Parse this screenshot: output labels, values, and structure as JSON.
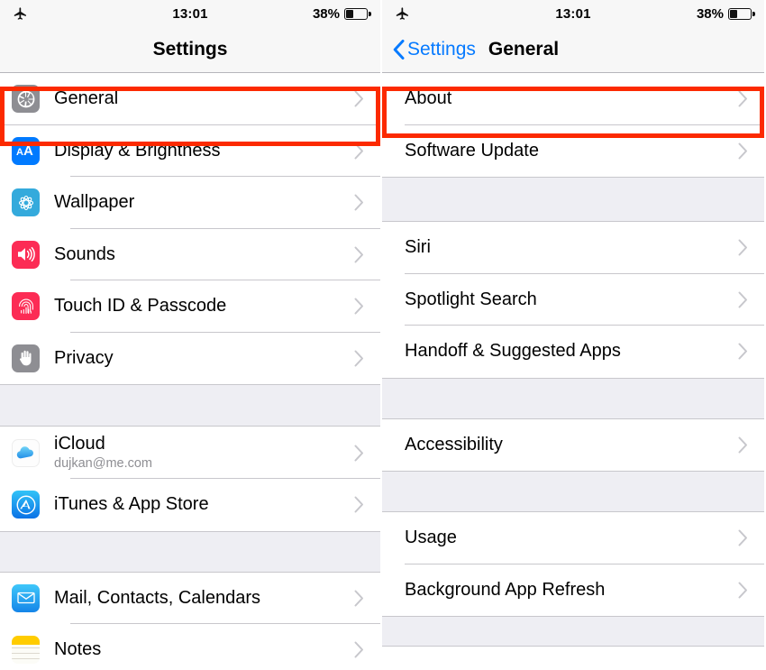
{
  "status_bar": {
    "airplane_icon": "airplane-icon",
    "time": "13:01",
    "battery_percent": "38%",
    "battery_level": 38
  },
  "colors": {
    "accent_blue": "#067aff",
    "highlight_red": "#fc2a00",
    "separator": "#c8c7cc",
    "group_bg": "#eeeef3",
    "subtitle_gray": "#8e8e93"
  },
  "left_panel": {
    "nav": {
      "title": "Settings"
    },
    "groups": [
      {
        "rows": [
          {
            "label": "General",
            "icon": "gear-icon",
            "icon_color": "#8e8e93",
            "highlighted": true
          },
          {
            "label": "Display & Brightness",
            "icon": "text-size-icon",
            "icon_color": "#007aff"
          },
          {
            "label": "Wallpaper",
            "icon": "flower-icon",
            "icon_color": "#34aadc"
          },
          {
            "label": "Sounds",
            "icon": "speaker-icon",
            "icon_color": "#fc2c55"
          },
          {
            "label": "Touch ID & Passcode",
            "icon": "fingerprint-icon",
            "icon_color": "#fc2c55"
          },
          {
            "label": "Privacy",
            "icon": "hand-icon",
            "icon_color": "#8e8e93"
          }
        ]
      },
      {
        "rows": [
          {
            "label": "iCloud",
            "subtitle": "dujkan@me.com",
            "icon": "cloud-icon",
            "icon_color": "#ffffff"
          },
          {
            "label": "iTunes & App Store",
            "icon": "app-store-icon",
            "icon_color": "#1b9df3"
          }
        ]
      },
      {
        "rows": [
          {
            "label": "Mail, Contacts, Calendars",
            "icon": "mail-icon",
            "icon_color": "#1d9bf5"
          },
          {
            "label": "Notes",
            "icon": "notes-icon",
            "icon_color": "#ffcc00"
          }
        ]
      }
    ]
  },
  "right_panel": {
    "nav": {
      "back_label": "Settings",
      "back_icon": "chevron-left-icon",
      "title": "General"
    },
    "groups": [
      {
        "rows": [
          {
            "label": "About",
            "highlighted": true
          },
          {
            "label": "Software Update"
          }
        ]
      },
      {
        "rows": [
          {
            "label": "Siri"
          },
          {
            "label": "Spotlight Search"
          },
          {
            "label": "Handoff & Suggested Apps"
          }
        ]
      },
      {
        "rows": [
          {
            "label": "Accessibility"
          }
        ]
      },
      {
        "rows": [
          {
            "label": "Usage"
          },
          {
            "label": "Background App Refresh"
          }
        ]
      }
    ]
  }
}
